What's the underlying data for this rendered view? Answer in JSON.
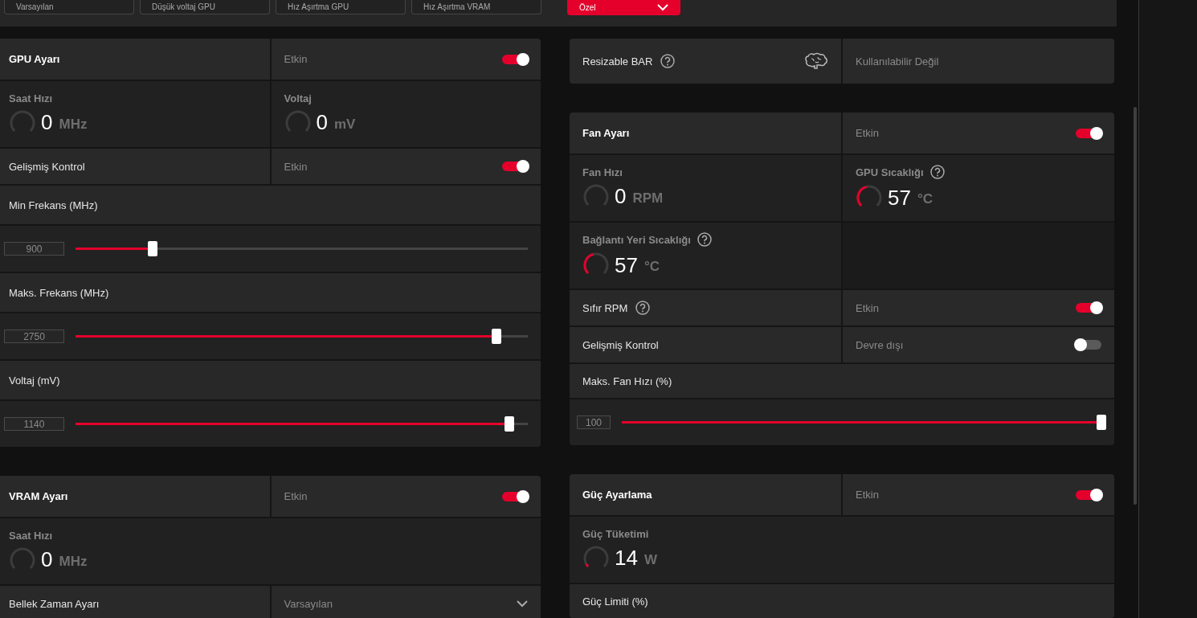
{
  "presets": [
    {
      "label": "Varsayılan",
      "selected": false
    },
    {
      "label": "Düşük voltaj GPU",
      "selected": false
    },
    {
      "label": "Hız Aşırtma GPU",
      "selected": false
    },
    {
      "label": "Hız Aşırtma VRAM",
      "selected": false
    },
    {
      "label": "Özel",
      "selected": true
    }
  ],
  "columns": [
    {
      "cards": [
        {
          "title": "GPU Ayarı",
          "status": "Etkin",
          "on": true,
          "rows": [
            {
              "kind": "metrics",
              "items": [
                {
                  "label": "Saat Hızı",
                  "help": false,
                  "value": "0",
                  "unit": "MHz"
                },
                {
                  "label": "Voltaj",
                  "help": false,
                  "value": "0",
                  "unit": "mV"
                }
              ]
            },
            {
              "kind": "toggle",
              "label": "Gelişmiş Kontrol",
              "help": false,
              "status": "Etkin",
              "on": true
            },
            {
              "kind": "label",
              "label": "Min Frekans (MHz)"
            },
            {
              "kind": "slider",
              "value": "900",
              "level": 0.17
            },
            {
              "kind": "label",
              "label": "Maks. Frekans (MHz)"
            },
            {
              "kind": "slider",
              "value": "2750",
              "level": 0.93
            },
            {
              "kind": "label",
              "label": "Voltaj (mV)"
            },
            {
              "kind": "slider",
              "value": "1140",
              "level": 0.96
            }
          ]
        },
        {
          "title": "VRAM Ayarı",
          "status": "Etkin",
          "on": true,
          "rows": [
            {
              "kind": "metrics",
              "items": [
                {
                  "label": "Saat Hızı",
                  "help": false,
                  "value": "0",
                  "unit": "MHz"
                }
              ]
            },
            {
              "kind": "dropdown",
              "label": "Bellek Zaman Ayarı",
              "value": "Varsayılan"
            }
          ]
        }
      ]
    },
    {
      "cards": [
        {
          "rows": [
            {
              "kind": "feature",
              "label": "Resizable BAR",
              "help": true,
              "status": "Kullanılabilir Değil"
            }
          ]
        },
        {
          "title": "Fan Ayarı",
          "status": "Etkin",
          "on": true,
          "rows": [
            {
              "kind": "metrics",
              "items": [
                {
                  "label": "Fan Hızı",
                  "help": false,
                  "value": "0",
                  "unit": "RPM"
                },
                {
                  "label": "GPU Sıcaklığı",
                  "help": true,
                  "value": "57",
                  "unit": "°C",
                  "level": 0.45
                }
              ]
            },
            {
              "kind": "metrics_half",
              "items": [
                {
                  "label": "Bağlantı Yeri Sıcaklığı",
                  "help": true,
                  "value": "57",
                  "unit": "°C",
                  "level": 0.45
                }
              ]
            },
            {
              "kind": "toggle",
              "label": "Sıfır RPM",
              "help": true,
              "status": "Etkin",
              "on": true
            },
            {
              "kind": "toggle",
              "label": "Gelişmiş Kontrol",
              "help": false,
              "status": "Devre dışı",
              "on": false
            },
            {
              "kind": "label",
              "label": "Maks. Fan Hızı (%)"
            },
            {
              "kind": "slider",
              "value": "100",
              "level": 1
            }
          ]
        },
        {
          "title": "Güç Ayarlama",
          "status": "Etkin",
          "on": true,
          "rows": [
            {
              "kind": "metrics",
              "items": [
                {
                  "label": "Güç Tüketimi",
                  "help": false,
                  "value": "14",
                  "unit": "W",
                  "level": 0.06
                }
              ]
            },
            {
              "kind": "label",
              "label": "Güç Limiti (%)"
            }
          ]
        }
      ]
    }
  ]
}
